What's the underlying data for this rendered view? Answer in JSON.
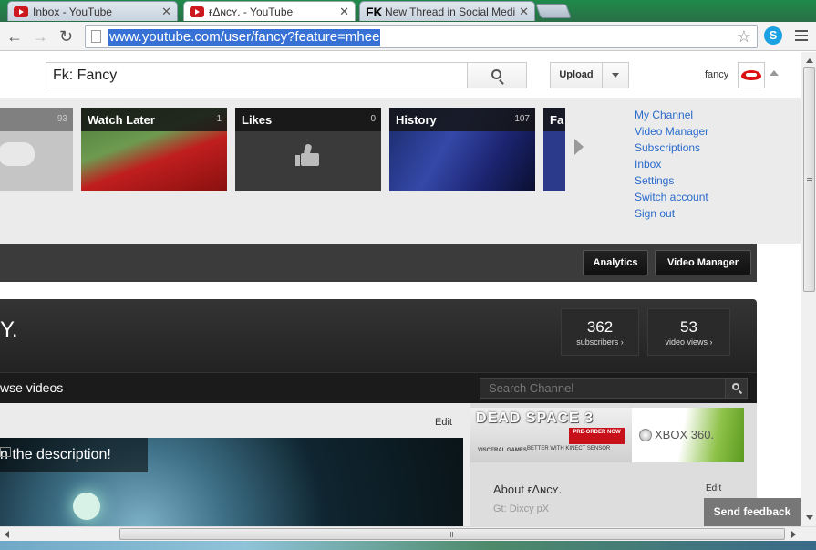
{
  "browser": {
    "tabs": [
      {
        "title": "Inbox - YouTube",
        "active": false
      },
      {
        "title": "ғΔɴᴄʏ. - YouTube",
        "active": true
      },
      {
        "title": "New Thread in Social Media",
        "active": false
      }
    ],
    "url": "www.youtube.com/user/fancy?feature=mhee"
  },
  "masthead": {
    "search_value": "Fk: Fancy",
    "upload_label": "Upload",
    "username": "fancy"
  },
  "guide": {
    "playlists": [
      {
        "title": "",
        "count": "93"
      },
      {
        "title": "Watch Later",
        "count": "1"
      },
      {
        "title": "Likes",
        "count": "0"
      },
      {
        "title": "History",
        "count": "107"
      },
      {
        "title": "Fa",
        "count": ""
      }
    ],
    "links": [
      "My Channel",
      "Video Manager",
      "Subscriptions",
      "Inbox",
      "Settings",
      "Switch account",
      "Sign out"
    ]
  },
  "channel_bar": {
    "analytics_label": "Analytics",
    "video_manager_label": "Video Manager"
  },
  "channel": {
    "name_fragment": "Y.",
    "stats": [
      {
        "value": "362",
        "label": "subscribers ›"
      },
      {
        "value": "53",
        "label": "video views ›"
      }
    ],
    "browse_label": "wse videos",
    "search_placeholder": "Search Channel"
  },
  "content": {
    "edit_label": "Edit",
    "video_title": "n the description!",
    "ad": {
      "dead_space": "DEAD SPACE 3",
      "preorder": "PRE-ORDER NOW",
      "visceral": "VISCERAL GAMES",
      "kinect": "BETTER WITH KINECT SENSOR",
      "xbox": "XBOX 360."
    },
    "about_title": "About ғΔɴᴄʏ.",
    "about_edit": "Edit",
    "about_sub": "Gt: Dixcy pX"
  },
  "feedback_label": "Send feedback"
}
